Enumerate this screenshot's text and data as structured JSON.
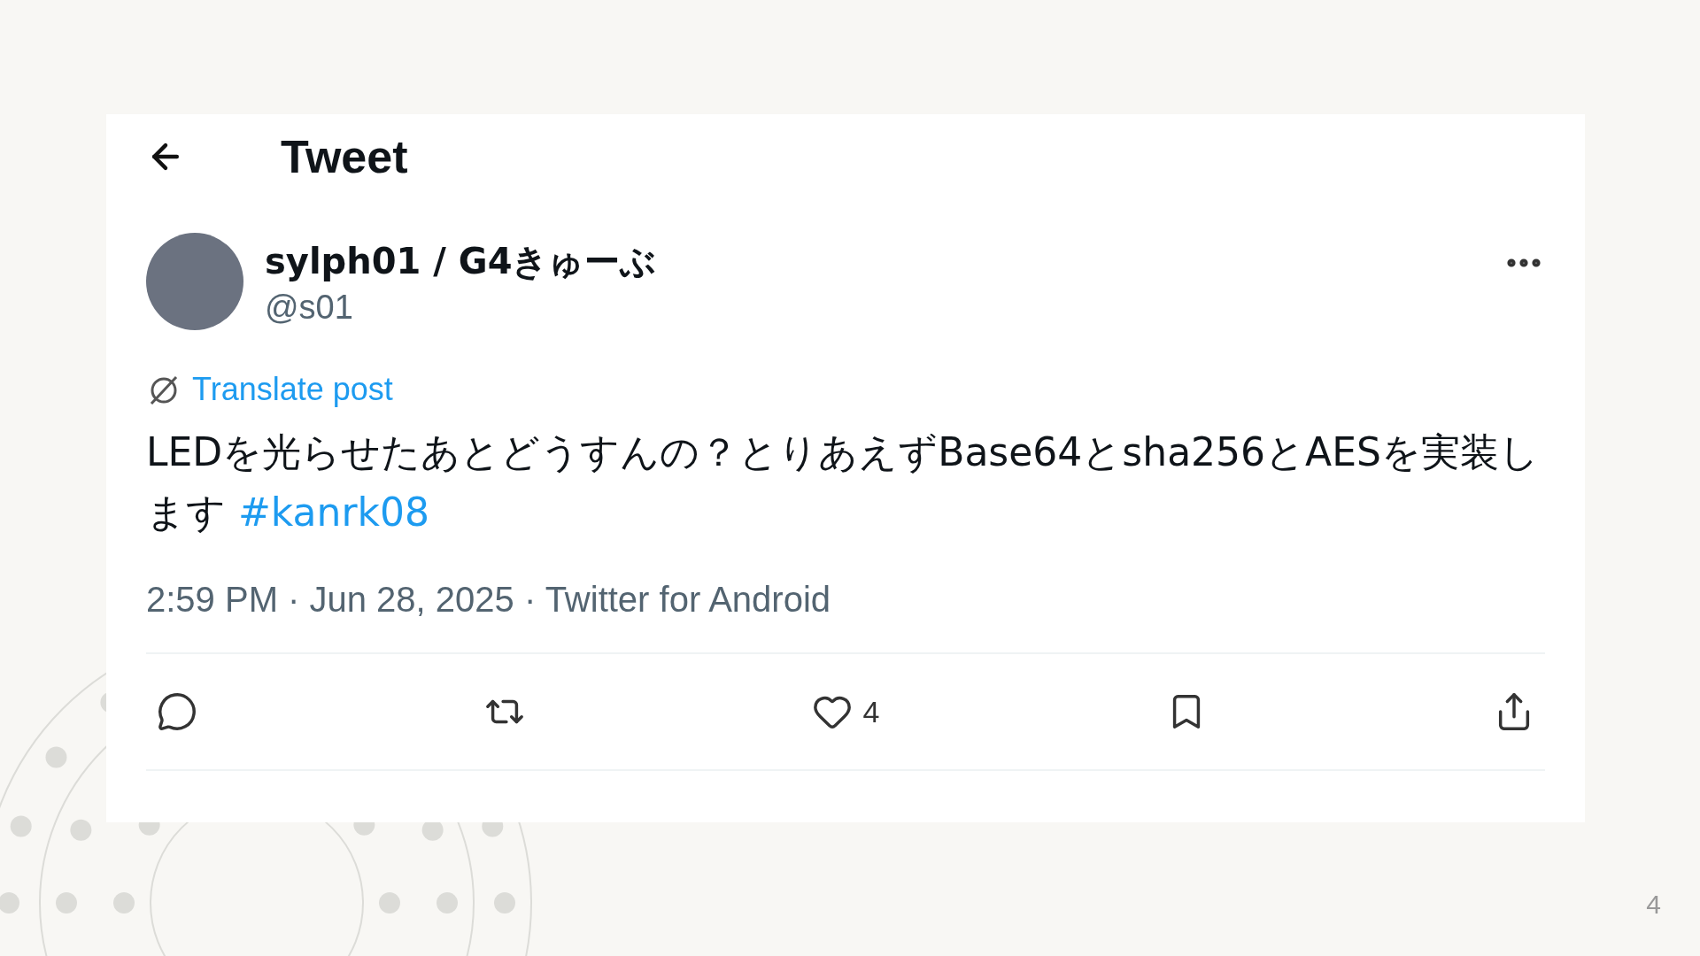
{
  "header": {
    "title": "Tweet"
  },
  "author": {
    "name": "sylph01 / G4きゅーぶ",
    "handle": "@s01"
  },
  "translate_link": "Translate post",
  "body": {
    "text": "LEDを光らせたあとどうすんの？とりあえずBase64とsha256とAESを実装します",
    "hashtag": "#kanrk08"
  },
  "meta": "2:59 PM · Jun 28, 2025 · Twitter for Android",
  "actions": [
    {
      "kind": "reply"
    },
    {
      "kind": "repost"
    },
    {
      "kind": "like",
      "count": "4"
    },
    {
      "kind": "bookmark"
    },
    {
      "kind": "share"
    }
  ],
  "slide_number": "4"
}
